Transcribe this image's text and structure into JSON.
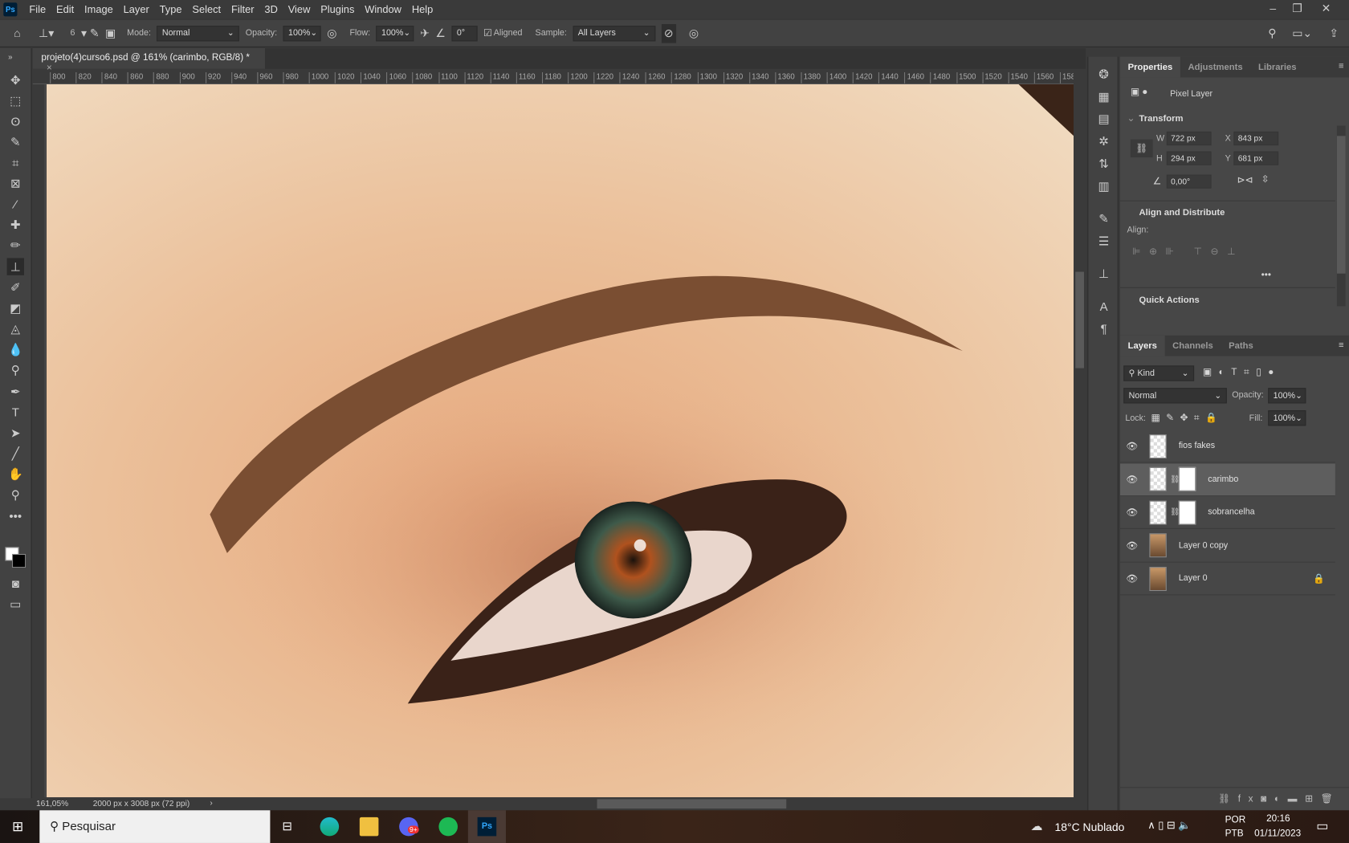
{
  "menu": {
    "logo": "Ps",
    "items": [
      "File",
      "Edit",
      "Image",
      "Layer",
      "Type",
      "Select",
      "Filter",
      "3D",
      "View",
      "Plugins",
      "Window",
      "Help"
    ]
  },
  "options": {
    "brush_size": "6",
    "mode_label": "Mode:",
    "mode": "Normal",
    "opacity_label": "Opacity:",
    "opacity": "100%",
    "flow_label": "Flow:",
    "flow": "100%",
    "angle": "0°",
    "aligned_label": "Aligned",
    "aligned": true,
    "sample_label": "Sample:",
    "sample": "All Layers"
  },
  "document": {
    "tab": "projeto(4)curso6.psd @ 161% (carimbo, RGB/8) *",
    "ruler_ticks": [
      "800",
      "820",
      "840",
      "860",
      "880",
      "900",
      "920",
      "940",
      "960",
      "980",
      "1000",
      "1020",
      "1040",
      "1060",
      "1080",
      "1100",
      "1120",
      "1140",
      "1160",
      "1180",
      "1200",
      "1220",
      "1240",
      "1260",
      "1280",
      "1300",
      "1320",
      "1340",
      "1360",
      "1380",
      "1400",
      "1420",
      "1440",
      "1460",
      "1480",
      "1500",
      "1520",
      "1540",
      "1560",
      "158"
    ]
  },
  "status": {
    "zoom": "161,05%",
    "info": "2000 px x 3008 px (72 ppi)"
  },
  "properties": {
    "tabs": [
      "Properties",
      "Adjustments",
      "Libraries"
    ],
    "type": "Pixel Layer",
    "transform_title": "Transform",
    "w_label": "W",
    "w": "722 px",
    "h_label": "H",
    "h": "294 px",
    "x_label": "X",
    "x": "843 px",
    "y_label": "Y",
    "y": "681 px",
    "angle": "0,00°",
    "align_title": "Align and Distribute",
    "align_label": "Align:",
    "more": "•••",
    "quick_actions": "Quick Actions"
  },
  "layers": {
    "tabs": [
      "Layers",
      "Channels",
      "Paths"
    ],
    "filter": "Kind",
    "blend": "Normal",
    "opacity_label": "Opacity:",
    "opacity": "100%",
    "lock_label": "Lock:",
    "fill_label": "Fill:",
    "fill": "100%",
    "items": [
      {
        "name": "fios fakes",
        "mask": false,
        "photo": false,
        "selected": false
      },
      {
        "name": "carimbo",
        "mask": true,
        "photo": false,
        "selected": true
      },
      {
        "name": "sobrancelha",
        "mask": true,
        "photo": false,
        "selected": false
      },
      {
        "name": "Layer 0 copy",
        "mask": false,
        "photo": true,
        "selected": false
      },
      {
        "name": "Layer 0",
        "mask": false,
        "photo": true,
        "selected": false,
        "locked": true
      }
    ]
  },
  "taskbar": {
    "search": "Pesquisar",
    "weather": "18°C  Nublado",
    "lang1": "POR",
    "lang2": "PTB",
    "time": "20:16",
    "date": "01/11/2023",
    "discord_badge": "9+"
  }
}
